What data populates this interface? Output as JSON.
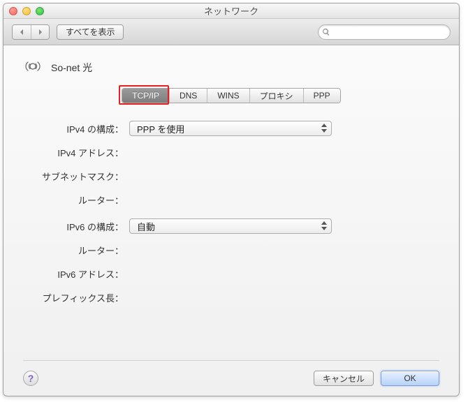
{
  "window": {
    "title": "ネットワーク"
  },
  "toolbar": {
    "show_all": "すべてを表示",
    "search_placeholder": ""
  },
  "connection": {
    "name": "So-net 光"
  },
  "tabs": {
    "tcpip": "TCP/IP",
    "dns": "DNS",
    "wins": "WINS",
    "proxy": "プロキシ",
    "ppp": "PPP"
  },
  "form": {
    "ipv4_config_label": "IPv4 の構成：",
    "ipv4_config_value": "PPP を使用",
    "ipv4_address_label": "IPv4 アドレス：",
    "subnet_label": "サブネットマスク：",
    "router_label": "ルーター：",
    "ipv6_config_label": "IPv6 の構成：",
    "ipv6_config_value": "自動",
    "router2_label": "ルーター：",
    "ipv6_address_label": "IPv6 アドレス：",
    "prefix_label": "プレフィックス長："
  },
  "buttons": {
    "cancel": "キャンセル",
    "ok": "OK",
    "help": "?"
  }
}
